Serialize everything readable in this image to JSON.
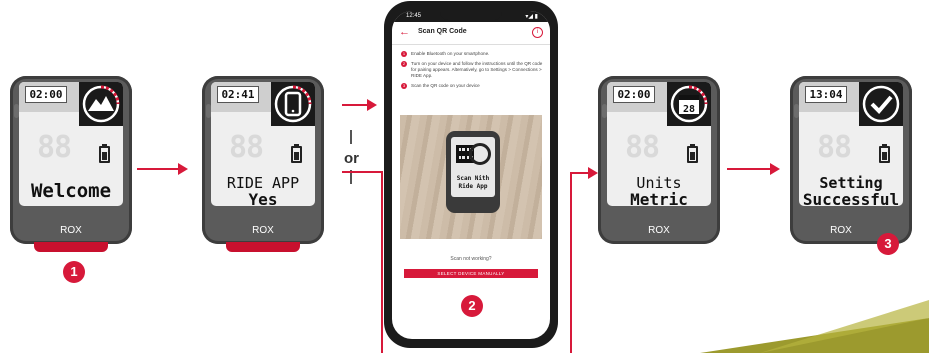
{
  "devices": [
    {
      "id": "welcome",
      "time": "02:00",
      "digits": "88",
      "line1": "",
      "line2": "",
      "single": "Welcome",
      "brand": "ROX"
    },
    {
      "id": "rideapp",
      "time": "02:41",
      "digits": "88",
      "line1": "RIDE APP",
      "line2": "Yes",
      "single": "",
      "brand": "ROX"
    },
    {
      "id": "units",
      "time": "02:00",
      "digits": "88",
      "line1": "Units",
      "line2": "Metric",
      "single": "",
      "brand": "ROX",
      "calendar_day": "28"
    },
    {
      "id": "success",
      "time": "13:04",
      "digits": "88",
      "line1": "Setting",
      "line2": "Successful",
      "single": "",
      "brand": "ROX"
    }
  ],
  "or_label": "or",
  "badges": {
    "one": "1",
    "two": "2",
    "three": "3"
  },
  "phone": {
    "status_time": "12:45",
    "status_icons": "▾◢ ▮",
    "back_icon": "←",
    "title": "Scan QR Code",
    "info_icon": "i",
    "steps": [
      {
        "num": "1",
        "text": "Enable Bluetooth on your smartphone."
      },
      {
        "num": "2",
        "text": "Turn on your device and follow the instructions until the QR code for pairing appears. Alternatively, go to Settings > Connections > RIDE App."
      },
      {
        "num": "3",
        "text": "Scan the QR code on your device"
      }
    ],
    "photo_text_line1": "Scan Nith",
    "photo_text_line2": "Ride App",
    "not_working": "Scan not working?",
    "select_button": "SELECT DEVICE MANUALLY"
  },
  "colors": {
    "accent": "#d7193a",
    "device_body": "#5b5b5b",
    "olive": "#9c9a2e"
  }
}
